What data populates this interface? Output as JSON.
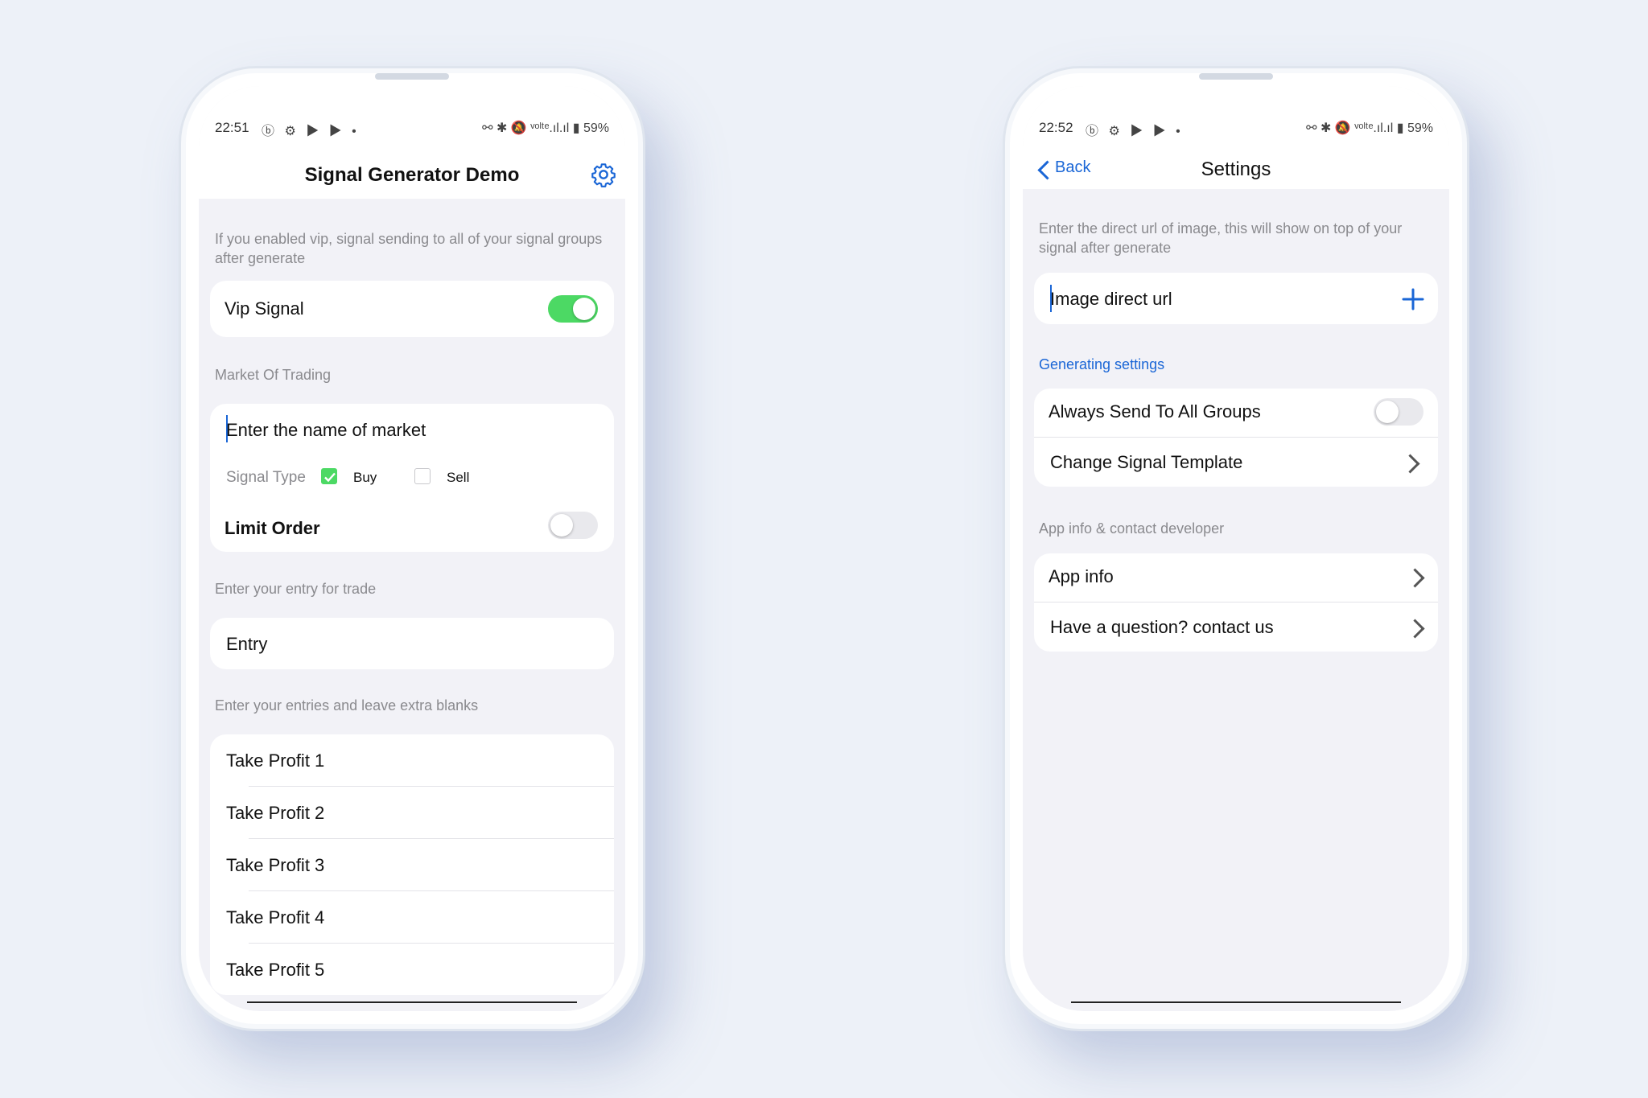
{
  "left": {
    "status": {
      "time": "22:51",
      "icons_left": "ⓑ ⚙ ▶ ▶ •",
      "icons_right": "⚯ ✱ 🔕 ᵛᵒˡᵗᵉ.ıl.ıl ▮ 59%"
    },
    "title": "Signal Generator Demo",
    "vip_hint": "If you enabled vip, signal sending to all of your signal groups after generate",
    "vip_label": "Vip Signal",
    "vip_on": true,
    "market_label": "Market Of Trading",
    "market_placeholder": "Enter the name of market",
    "signal_type_label": "Signal Type",
    "buy_label": "Buy",
    "sell_label": "Sell",
    "limit_order_label": "Limit Order",
    "entry_hint": "Enter your entry for trade",
    "entry_placeholder": "Entry",
    "tp_hint": "Enter your entries and leave extra blanks",
    "take_profits": [
      "Take Profit 1",
      "Take Profit 2",
      "Take Profit 3",
      "Take Profit 4",
      "Take Profit 5"
    ]
  },
  "right": {
    "status": {
      "time": "22:52",
      "icons_left": "ⓑ ⚙ ▶ ▶ •",
      "icons_right": "⚯ ✱ 🔕 ᵛᵒˡᵗᵉ.ıl.ıl ▮ 59%"
    },
    "back_label": "Back",
    "title": "Settings",
    "image_hint": "Enter the direct url of image, this will show on top of your signal after generate",
    "image_placeholder": "Image direct url",
    "generating_label": "Generating settings",
    "always_send_label": "Always Send To All Groups",
    "change_template_label": "Change Signal Template",
    "app_info_section": "App info & contact developer",
    "app_info_label": "App info",
    "contact_label": "Have a question? contact us"
  },
  "colors": {
    "accent": "#1a66d6",
    "toggle_on": "#4cd964",
    "background": "#f2f2f7"
  }
}
